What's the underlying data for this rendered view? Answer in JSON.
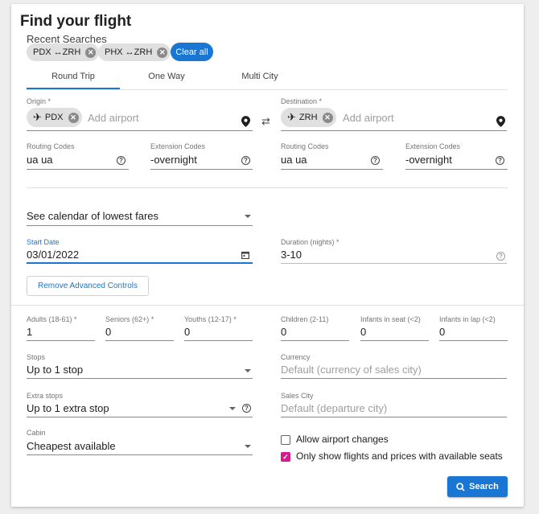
{
  "header": {
    "title": "Find your flight"
  },
  "recent": {
    "label": "Recent Searches",
    "items": [
      "PDX ↔ZRH",
      "PHX ↔ZRH"
    ],
    "clear_label": "Clear all"
  },
  "tabs": [
    "Round Trip",
    "One Way",
    "Multi City"
  ],
  "origin": {
    "label": "Origin *",
    "chip": "PDX",
    "placeholder": "Add airport"
  },
  "destination": {
    "label": "Destination *",
    "chip": "ZRH",
    "placeholder": "Add airport"
  },
  "codes": {
    "routing_label": "Routing Codes",
    "extension_label": "Extension Codes",
    "left_routing": "ua ua",
    "left_extension": "-overnight",
    "right_routing": "ua ua",
    "right_extension": "-overnight"
  },
  "calendar": {
    "value": "See calendar of lowest fares"
  },
  "start_date": {
    "label": "Start Date",
    "value": "03/01/2022"
  },
  "duration": {
    "label": "Duration (nights) *",
    "value": "3-10"
  },
  "remove_advanced_label": "Remove Advanced Controls",
  "passengers": [
    {
      "label": "Adults (18-61) *",
      "value": "1"
    },
    {
      "label": "Seniors (62+) *",
      "value": "0"
    },
    {
      "label": "Youths (12-17) *",
      "value": "0"
    },
    {
      "label": "Children (2-11)",
      "value": "0"
    },
    {
      "label": "Infants in seat (<2)",
      "value": "0"
    },
    {
      "label": "Infants in lap (<2)",
      "value": "0"
    }
  ],
  "stops": {
    "label": "Stops",
    "value": "Up to 1 stop"
  },
  "currency": {
    "label": "Currency",
    "placeholder": "Default (currency of sales city)"
  },
  "extra_stops": {
    "label": "Extra stops",
    "value": "Up to 1 extra stop"
  },
  "sales_city": {
    "label": "Sales City",
    "placeholder": "Default (departure city)"
  },
  "cabin": {
    "label": "Cabin",
    "value": "Cheapest available"
  },
  "options": {
    "allow_airport_changes": {
      "label": "Allow airport changes",
      "checked": false
    },
    "available_seats": {
      "label": "Only show flights and prices with available seats",
      "checked": true
    }
  },
  "search_label": "Search",
  "colors": {
    "accent": "#1976d2",
    "checkbox": "#d81b8c"
  }
}
